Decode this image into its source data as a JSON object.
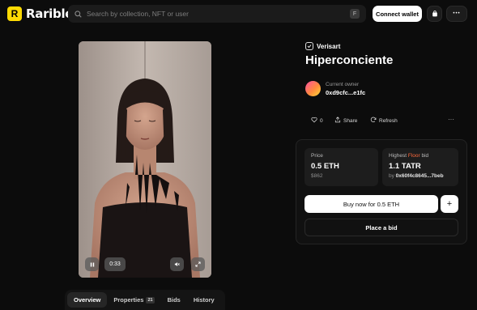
{
  "header": {
    "logo_text": "Rarible",
    "logo_mark": "R",
    "search_placeholder": "Search by collection, NFT or user",
    "search_shortcut": "F",
    "connect_wallet": "Connect wallet",
    "more_dots": "•••"
  },
  "media": {
    "time": "0:33"
  },
  "tabs": [
    {
      "label": "Overview",
      "active": true
    },
    {
      "label": "Properties",
      "count": "21"
    },
    {
      "label": "Bids"
    },
    {
      "label": "History"
    }
  ],
  "item": {
    "creator": "Verisart",
    "title": "Hiperconciente",
    "owner_label": "Current owner",
    "owner_address": "0xd9cfc...e1fc"
  },
  "actions": {
    "likes": "0",
    "share": "Share",
    "refresh": "Refresh",
    "menu": "···"
  },
  "price": {
    "label": "Price",
    "value": "0.5 ETH",
    "usd": "$862"
  },
  "highest_bid": {
    "label_prefix": "Highest ",
    "label_floor": "Floor",
    "label_suffix": " bid",
    "value": "1.1 TATR",
    "by_prefix": "by ",
    "bidder": "0x60f4c8645...7beb"
  },
  "buttons": {
    "buy": "Buy now for 0.5 ETH",
    "plus": "+",
    "place_bid": "Place a bid"
  },
  "colors": {
    "brand_yellow": "#feda03",
    "floor_accent": "#ff6a3d",
    "background": "#0c0c0c"
  }
}
